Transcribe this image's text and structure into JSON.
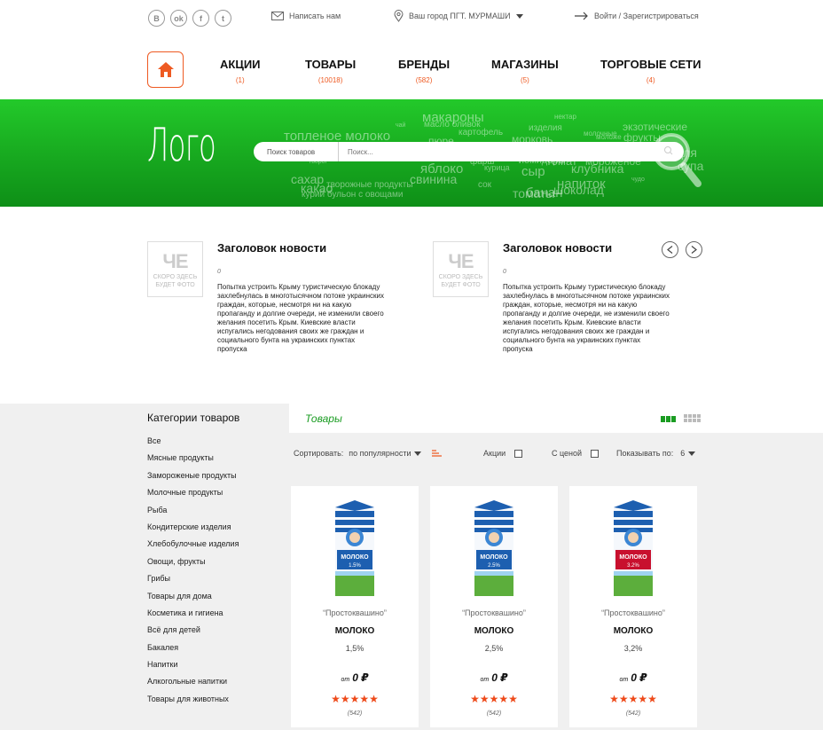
{
  "topbar": {
    "social": [
      "B",
      "ok",
      "f",
      "t"
    ],
    "write_us": "Написать нам",
    "city": "Ваш город ПГТ. МУРМАШИ",
    "login": "Войти / Зарегистрироваться"
  },
  "nav": {
    "items": [
      {
        "label": "АКЦИИ",
        "count": "(1)"
      },
      {
        "label": "ТОВАРЫ",
        "count": "(10018)"
      },
      {
        "label": "БРЕНДЫ",
        "count": "(582)"
      },
      {
        "label": "МАГАЗИНЫ",
        "count": "(5)"
      },
      {
        "label": "ТОРГОВЫЕ СЕТИ",
        "count": "(4)"
      }
    ]
  },
  "hero": {
    "logo": "Лого",
    "search_category": "Поиск товаров",
    "search_placeholder": "Поиск...",
    "tag_cloud": [
      "макароны",
      "топленое молоко",
      "масло оливок",
      "картофель",
      "изделия",
      "нектар",
      "экзотические",
      "фрукты",
      "чай",
      "молочные",
      "пюре",
      "морковь",
      "моложе",
      "творог",
      "фарш",
      "овощи",
      "помидоры",
      "томат",
      "для",
      "супа",
      "яблоко",
      "клубника",
      "свинина",
      "сыр",
      "мороженое",
      "сахар",
      "какао",
      "напиток",
      "сок",
      "шоколад",
      "творожные продукты",
      "курица",
      "банан",
      "томаты",
      "чудо",
      "курий бульон с овощами"
    ]
  },
  "news": [
    {
      "title": "Заголовок новости",
      "num": "0",
      "text": "Попытка устроить Крыму туристическую блокаду захлебнулась в многотысячном потоке украинских граждан, которые, несмотря ни на какую пропаганду и долгие очереди, не изменили своего желания посетить Крым. Киевские власти испугались негодования своих же граждан и социального бунта на украинских пунктах пропуска",
      "photo": "СКОРО ЗДЕСЬ БУДЕТ ФОТО"
    },
    {
      "title": "Заголовок новости",
      "num": "0",
      "text": "Попытка устроить Крыму туристическую блокаду захлебнулась в многотысячном потоке украинских граждан, которые, несмотря ни на какую пропаганду и долгие очереди, не изменили своего желания посетить Крым. Киевские власти испугались негодования своих же граждан и социального бунта на украинских пунктах пропуска",
      "photo": "СКОРО ЗДЕСЬ БУДЕТ ФОТО"
    }
  ],
  "sidebar": {
    "title": "Категории товаров",
    "categories": [
      "Все",
      "Мясные продукты",
      "Замороженые продукты",
      "Молочные продукты",
      "Рыба",
      "Кондитерские изделия",
      "Хлебобулочные изделия",
      "Овощи, фрукты",
      "Грибы",
      "Товары для дома",
      "Косметика и гигиена",
      "Всё для детей",
      "Бакалея",
      "Напитки",
      "Алкогольные напитки",
      "Товары для животных"
    ]
  },
  "products": {
    "title": "Товары",
    "sort_label": "Сортировать:",
    "sort_value": "по популярности",
    "filter_promo": "Акции",
    "filter_price": "С ценой",
    "show_label": "Показывать по:",
    "show_value": "6",
    "items": [
      {
        "brand": "“Простоквашино”",
        "name": "МОЛОКО",
        "fat": "1,5%",
        "from": "от",
        "price": "0 ₽",
        "stars": "★★★★★",
        "reviews": "(542)",
        "pack_fat": "1.5%"
      },
      {
        "brand": "“Простоквашино”",
        "name": "МОЛОКО",
        "fat": "2,5%",
        "from": "от",
        "price": "0 ₽",
        "stars": "★★★★★",
        "reviews": "(542)",
        "pack_fat": "2.5%"
      },
      {
        "brand": "“Простоквашино”",
        "name": "МОЛОКО",
        "fat": "3,2%",
        "from": "от",
        "price": "0 ₽",
        "stars": "★★★★★",
        "reviews": "(542)",
        "pack_fat": "3.2%"
      }
    ]
  },
  "colors": {
    "accent": "#ee5a22",
    "green": "#1a9c22",
    "hero_top": "#23c92a",
    "hero_bottom": "#0e8f17"
  }
}
